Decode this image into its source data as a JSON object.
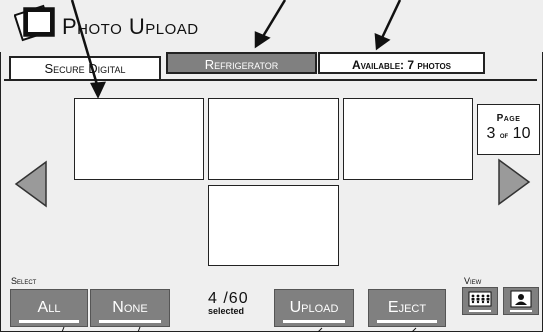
{
  "app": {
    "title": "Photo Upload",
    "icon": "photos-icon"
  },
  "tabs": [
    {
      "label": "Secure Digital",
      "state": "active"
    },
    {
      "label": "Refrigerator",
      "state": "inactive"
    }
  ],
  "availability": {
    "label": "Available: 7 photos"
  },
  "gallery": {
    "thumbnails": [
      "",
      "",
      "",
      ""
    ],
    "page": {
      "label": "Page",
      "current": "3",
      "of_label": "of",
      "total": "10"
    },
    "prev_icon": "left-triangle-icon",
    "next_icon": "right-triangle-icon"
  },
  "footer": {
    "select_label": "Select",
    "select_all": "All",
    "select_none": "None",
    "count_value": "4 /60",
    "count_sub": "selected",
    "upload": "Upload",
    "eject": "Eject",
    "view_label": "View",
    "view_grid_icon": "grid-view-icon",
    "view_single_icon": "single-view-icon"
  },
  "colors": {
    "background": "#efefef",
    "button": "#808080",
    "button_text": "#ffffff",
    "outline": "#222222",
    "arrow_fill": "#9a9a9a"
  }
}
